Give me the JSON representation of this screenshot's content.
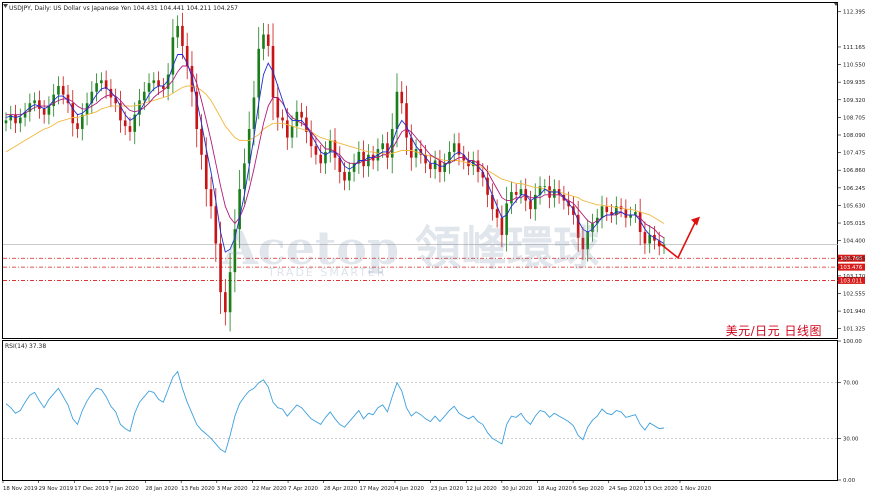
{
  "header": {
    "title": "USDJPY, Daily:  US Dollar vs Japanese Yen  104.431 104.441 104.211 104.257"
  },
  "overlay": {
    "cn_caption": "美元/日元    日线图",
    "watermark": "Acetop 領峰環球",
    "watermark_sub": "TRADE SMARTER"
  },
  "colors": {
    "bull": "#1a7f1a",
    "bear": "#c81414",
    "ma_fast": "#1c2cd1",
    "ma_mid": "#b01a7a",
    "ma_slow": "#f2b73c",
    "rsi": "#3ea0dc",
    "forecast_arrow": "#e01010",
    "level_lines": "#d81a1a"
  },
  "chart_data": [
    {
      "type": "candlestick",
      "title": "USDJPY, Daily",
      "y_ticks": [
        "112.395",
        "111.165",
        "110.550",
        "109.935",
        "109.320",
        "108.705",
        "108.090",
        "107.475",
        "106.860",
        "106.245",
        "105.630",
        "105.015",
        "104.400",
        "103.785",
        "103.170",
        "102.555",
        "101.940",
        "101.325"
      ],
      "x_ticks": [
        "18 Nov 2019",
        "29 Nov 2019",
        "17 Dec 2019",
        "7 Jan 2020",
        "28 Jan 2020",
        "13 Feb 2020",
        "3 Mar 2020",
        "22 Mar 2020",
        "7 Apr 2020",
        "28 Apr 2020",
        "17 May 2020",
        "4 Jun 2020",
        "23 Jun 2020",
        "12 Jul 2020",
        "30 Jul 2020",
        "18 Aug 2020",
        "6 Sep 2020",
        "24 Sep 2020",
        "13 Oct 2020",
        "1 Nov 2020"
      ],
      "ylim": [
        101.0,
        112.7
      ],
      "close_path": [
        108.6,
        108.8,
        108.5,
        108.7,
        108.9,
        109.2,
        109.3,
        109.0,
        108.8,
        109.1,
        109.5,
        109.8,
        109.5,
        109.2,
        108.5,
        108.3,
        108.8,
        109.2,
        109.6,
        109.9,
        110.0,
        109.7,
        109.4,
        109.2,
        108.6,
        108.4,
        108.2,
        108.8,
        109.3,
        109.6,
        109.9,
        110.0,
        109.8,
        109.7,
        110.2,
        111.5,
        111.9,
        111.2,
        110.5,
        109.6,
        108.3,
        107.4,
        106.2,
        105.6,
        104.3,
        102.6,
        101.9,
        103.3,
        104.8,
        106.2,
        107.1,
        108.3,
        109.4,
        111.1,
        111.6,
        111.2,
        109.4,
        108.7,
        108.6,
        108.0,
        108.4,
        108.9,
        108.7,
        108.2,
        107.7,
        107.4,
        107.1,
        107.5,
        107.9,
        107.3,
        106.8,
        106.5,
        106.8,
        107.1,
        107.5,
        107.0,
        107.4,
        107.2,
        107.6,
        107.8,
        107.3,
        108.3,
        109.6,
        109.2,
        108.0,
        107.3,
        107.6,
        107.4,
        107.1,
        106.9,
        107.2,
        106.8,
        107.1,
        107.5,
        107.8,
        107.4,
        107.2,
        107.0,
        107.2,
        106.8,
        106.6,
        106.0,
        105.5,
        105.2,
        104.6,
        105.7,
        106.1,
        106.0,
        106.2,
        105.8,
        105.5,
        106.0,
        106.3,
        106.3,
        105.9,
        106.2,
        106.0,
        105.8,
        105.6,
        105.3,
        104.5,
        104.1,
        104.7,
        105.0,
        105.2,
        105.6,
        105.4,
        105.3,
        105.6,
        105.5,
        105.2,
        105.3,
        105.4,
        104.7,
        104.3,
        104.6,
        104.4,
        104.2,
        104.26
      ],
      "ma_fast": [
        108.7,
        108.75,
        108.7,
        108.75,
        108.9,
        109.05,
        109.15,
        109.1,
        109.0,
        109.1,
        109.3,
        109.45,
        109.45,
        109.3,
        109.0,
        108.8,
        108.85,
        109.0,
        109.25,
        109.5,
        109.7,
        109.75,
        109.6,
        109.4,
        109.1,
        108.8,
        108.6,
        108.7,
        108.9,
        109.2,
        109.5,
        109.7,
        109.8,
        109.8,
        110.0,
        110.5,
        110.9,
        110.9,
        110.6,
        110.1,
        109.3,
        108.5,
        107.6,
        106.8,
        105.8,
        104.7,
        104.0,
        104.1,
        104.5,
        105.2,
        106.0,
        107.0,
        108.0,
        109.2,
        110.2,
        110.6,
        110.3,
        109.8,
        109.3,
        108.8,
        108.6,
        108.6,
        108.6,
        108.4,
        108.1,
        107.8,
        107.5,
        107.4,
        107.5,
        107.5,
        107.3,
        107.0,
        106.9,
        107.0,
        107.2,
        107.2,
        107.3,
        107.3,
        107.4,
        107.5,
        107.5,
        107.8,
        108.3,
        108.6,
        108.4,
        108.0,
        107.7,
        107.5,
        107.3,
        107.1,
        107.1,
        107.0,
        107.0,
        107.2,
        107.4,
        107.5,
        107.4,
        107.2,
        107.1,
        107.0,
        106.8,
        106.4,
        106.0,
        105.6,
        105.2,
        105.3,
        105.6,
        105.8,
        106.0,
        106.0,
        105.8,
        105.9,
        106.0,
        106.2,
        106.1,
        106.1,
        106.1,
        105.9,
        105.7,
        105.5,
        105.1,
        104.8,
        104.7,
        104.8,
        105.0,
        105.2,
        105.3,
        105.3,
        105.4,
        105.4,
        105.3,
        105.3,
        105.3,
        105.1,
        104.8,
        104.6,
        104.5,
        104.4,
        104.3
      ],
      "ma_mid": [
        108.8,
        108.8,
        108.8,
        108.8,
        108.85,
        108.95,
        109.05,
        109.1,
        109.1,
        109.1,
        109.2,
        109.3,
        109.35,
        109.35,
        109.25,
        109.1,
        109.0,
        109.0,
        109.1,
        109.2,
        109.35,
        109.45,
        109.5,
        109.45,
        109.3,
        109.1,
        108.95,
        108.9,
        108.95,
        109.05,
        109.2,
        109.4,
        109.55,
        109.65,
        109.8,
        110.0,
        110.3,
        110.5,
        110.5,
        110.3,
        109.9,
        109.3,
        108.6,
        107.9,
        107.1,
        106.3,
        105.6,
        105.2,
        105.0,
        105.2,
        105.6,
        106.2,
        106.9,
        107.7,
        108.5,
        109.1,
        109.4,
        109.4,
        109.2,
        108.9,
        108.7,
        108.6,
        108.5,
        108.4,
        108.2,
        108.0,
        107.8,
        107.6,
        107.6,
        107.5,
        107.4,
        107.2,
        107.1,
        107.1,
        107.1,
        107.2,
        107.2,
        107.3,
        107.3,
        107.4,
        107.4,
        107.6,
        107.9,
        108.2,
        108.3,
        108.2,
        108.0,
        107.8,
        107.6,
        107.4,
        107.3,
        107.2,
        107.1,
        107.1,
        107.2,
        107.3,
        107.3,
        107.2,
        107.2,
        107.1,
        107.0,
        106.8,
        106.5,
        106.2,
        105.9,
        105.8,
        105.8,
        105.9,
        105.9,
        106.0,
        105.9,
        105.9,
        105.9,
        106.0,
        106.0,
        106.0,
        106.0,
        105.9,
        105.8,
        105.7,
        105.5,
        105.3,
        105.1,
        105.0,
        105.1,
        105.2,
        105.3,
        105.3,
        105.3,
        105.4,
        105.3,
        105.3,
        105.3,
        105.2,
        105.0,
        104.9,
        104.8,
        104.6,
        104.5
      ],
      "ma_slow": [
        107.5,
        107.6,
        107.7,
        107.8,
        107.9,
        108.0,
        108.1,
        108.2,
        108.3,
        108.35,
        108.45,
        108.55,
        108.6,
        108.65,
        108.7,
        108.7,
        108.75,
        108.8,
        108.85,
        108.9,
        109.0,
        109.05,
        109.1,
        109.1,
        109.1,
        109.1,
        109.1,
        109.1,
        109.15,
        109.2,
        109.25,
        109.3,
        109.35,
        109.4,
        109.45,
        109.55,
        109.65,
        109.75,
        109.8,
        109.8,
        109.75,
        109.65,
        109.5,
        109.3,
        109.0,
        108.7,
        108.4,
        108.2,
        108.0,
        107.9,
        107.9,
        107.9,
        108.0,
        108.1,
        108.3,
        108.4,
        108.5,
        108.5,
        108.5,
        108.45,
        108.4,
        108.35,
        108.3,
        108.25,
        108.2,
        108.1,
        108.0,
        107.95,
        107.9,
        107.85,
        107.8,
        107.75,
        107.7,
        107.65,
        107.6,
        107.55,
        107.5,
        107.5,
        107.45,
        107.45,
        107.4,
        107.45,
        107.5,
        107.55,
        107.55,
        107.55,
        107.5,
        107.45,
        107.4,
        107.35,
        107.3,
        107.25,
        107.2,
        107.2,
        107.2,
        107.2,
        107.15,
        107.1,
        107.05,
        107.0,
        106.95,
        106.85,
        106.75,
        106.65,
        106.55,
        106.5,
        106.45,
        106.4,
        106.4,
        106.35,
        106.3,
        106.25,
        106.25,
        106.2,
        106.15,
        106.1,
        106.1,
        106.05,
        106.0,
        105.95,
        105.9,
        105.8,
        105.75,
        105.7,
        105.65,
        105.65,
        105.6,
        105.6,
        105.55,
        105.55,
        105.5,
        105.5,
        105.45,
        105.4,
        105.35,
        105.3,
        105.2,
        105.1,
        105.0
      ],
      "horizontal_levels": [
        103.786,
        103.476,
        103.011
      ],
      "forecast": [
        {
          "x": 0,
          "y": 104.3
        },
        {
          "x": 1,
          "y": 103.8
        },
        {
          "x": 2,
          "y": 105.1
        }
      ]
    },
    {
      "type": "line",
      "title": "RSI(14) 37.38",
      "ylim": [
        0,
        100
      ],
      "y_ticks": [
        "100.00",
        "70.00",
        "30.00",
        "0.00"
      ],
      "reference_lines": [
        70,
        30
      ],
      "values": [
        55,
        52,
        48,
        50,
        56,
        61,
        63,
        57,
        52,
        58,
        62,
        66,
        60,
        54,
        44,
        40,
        50,
        57,
        62,
        66,
        65,
        60,
        53,
        49,
        40,
        37,
        35,
        48,
        56,
        60,
        64,
        63,
        58,
        56,
        65,
        74,
        78,
        66,
        56,
        48,
        40,
        36,
        33,
        30,
        26,
        22,
        20,
        32,
        46,
        55,
        60,
        64,
        66,
        70,
        72,
        67,
        56,
        52,
        51,
        46,
        50,
        54,
        52,
        48,
        44,
        42,
        40,
        45,
        49,
        44,
        40,
        38,
        42,
        46,
        50,
        44,
        48,
        47,
        52,
        54,
        49,
        60,
        70,
        64,
        52,
        46,
        49,
        47,
        44,
        42,
        46,
        42,
        46,
        50,
        53,
        48,
        46,
        44,
        46,
        42,
        40,
        34,
        30,
        28,
        26,
        40,
        46,
        45,
        48,
        43,
        40,
        46,
        50,
        49,
        45,
        48,
        46,
        44,
        42,
        39,
        32,
        29,
        38,
        43,
        46,
        51,
        48,
        47,
        50,
        49,
        45,
        46,
        47,
        40,
        36,
        41,
        39,
        37,
        37.38
      ]
    }
  ]
}
